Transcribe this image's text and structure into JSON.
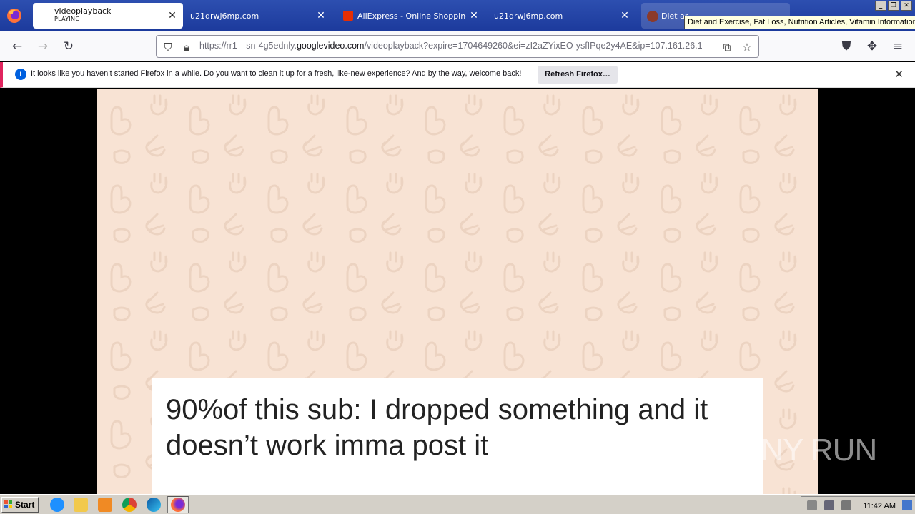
{
  "browser": {
    "tabs": [
      {
        "title": "videoplayback",
        "subtitle": "PLAYING",
        "active": true
      },
      {
        "title": "u21drwj6mp.com",
        "active": false
      },
      {
        "title": "AliExpress - Online Shopping für",
        "active": false
      },
      {
        "title": "u21drwj6mp.com",
        "active": false
      },
      {
        "title": "Diet ar",
        "active": false
      }
    ],
    "tooltip": "Diet and Exercise, Fat Loss, Nutrition Articles, Vitamin Information",
    "url": {
      "prefix": "https://rr1---sn-4g5ednly.",
      "host": "googlevideo.com",
      "suffix": "/videoplayback?expire=1704649260&ei=zI2aZYixEO-ysfIPqe2y4AE&ip=107.161.26.1"
    }
  },
  "notification": {
    "message": "It looks like you haven’t started Firefox in a while. Do you want to clean it up for a fresh, like-new experience? And by the way, welcome back!",
    "button": "Refresh Firefox…"
  },
  "video": {
    "caption_line1": "90%of this sub: I dropped something and it",
    "caption_line2": "doesn’t work imma post it",
    "watermark": "ANY RUN"
  },
  "taskbar": {
    "start_label": "Start",
    "clock": "11:42 AM"
  },
  "colors": {
    "tab_bar": "#2d4fb0",
    "video_bg": "#f8e3d4",
    "notification_accent": "#e0245e"
  }
}
